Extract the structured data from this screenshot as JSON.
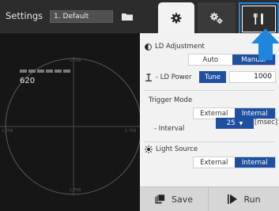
{
  "topbar": {
    "title": "Settings",
    "profile": "1. Default"
  },
  "viewer": {
    "signal_value": "620",
    "level_fraction": 1.0,
    "axis_labels": {
      "top": "1.758",
      "bottom": "1.758",
      "left": "1.758",
      "right": "1.758"
    }
  },
  "panel": {
    "ld_adjustment": {
      "label": "LD Adjustment",
      "options": [
        "Auto",
        "Manual"
      ],
      "selected": "Manual"
    },
    "ld_power": {
      "label": "- LD Power",
      "tune_label": "Tune",
      "value": "1000"
    },
    "trigger_mode": {
      "label": "Trigger Mode",
      "options": [
        "External",
        "Internal"
      ],
      "selected": "Internal"
    },
    "interval": {
      "label": "- Interval",
      "value": "25",
      "unit": "[msec]"
    },
    "light_source": {
      "label": "Light Source",
      "options": [
        "External",
        "Internal"
      ],
      "selected": "Internal"
    }
  },
  "actions": {
    "save_label": "Save",
    "run_label": "Run"
  },
  "colors": {
    "accent": "#1f4fa0",
    "highlight": "#1e86dc",
    "panel_bg": "#f2f2f2",
    "viewer_bg": "#161616"
  },
  "icons": {
    "folder": "folder-icon",
    "tab_settings": "gear-icon",
    "tab_advanced": "gears-icon",
    "tab_tools": "tools-icon",
    "ld_adjustment": "contrast-icon",
    "ld_power": "laser-power-icon",
    "light_source": "sun-icon",
    "save": "save-icon",
    "run": "run-icon",
    "callout": "arrow-up-icon"
  }
}
